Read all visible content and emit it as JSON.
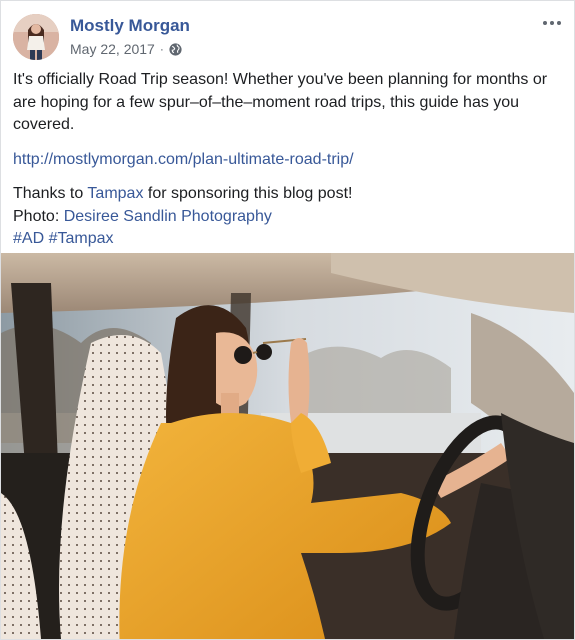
{
  "post": {
    "author": "Mostly Morgan",
    "date": "May 22, 2017",
    "separator": "·",
    "icons": {
      "privacy": "globe-icon",
      "more": "more-options-icon"
    },
    "text": "It's officially Road Trip season! Whether you've been planning for months or are hoping for a few spur–of–the–moment road trips, this guide has you covered.",
    "link": "http://mostlymorgan.com/plan-ultimate-road-trip/",
    "thanks_prefix": "Thanks to ",
    "thanks_brand": "Tampax",
    "thanks_suffix": " for sponsoring this blog post!",
    "photo_prefix": "Photo: ",
    "photo_credit": "Desiree Sandlin Photography",
    "hashtags": [
      "#AD",
      "#Tampax"
    ]
  },
  "colors": {
    "link": "#385898",
    "text": "#1c1e21",
    "meta": "#606770"
  }
}
